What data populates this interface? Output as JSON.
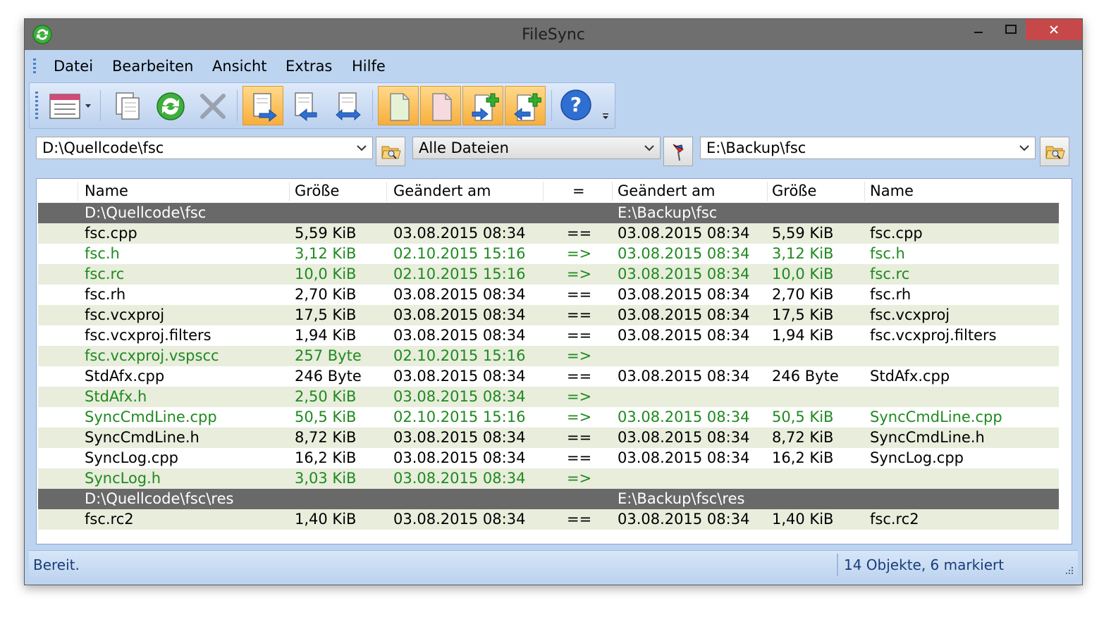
{
  "window": {
    "title": "FileSync"
  },
  "menu": {
    "items": [
      "Datei",
      "Bearbeiten",
      "Ansicht",
      "Extras",
      "Hilfe"
    ]
  },
  "paths": {
    "left": "D:\\Quellcode\\fsc",
    "filter": "Alle Dateien",
    "right": "E:\\Backup\\fsc"
  },
  "columns": {
    "name": "Name",
    "size": "Größe",
    "modified": "Geändert am",
    "compare": "=",
    "modified_right": "Geändert am",
    "size_right": "Größe",
    "name_right": "Name"
  },
  "rows": [
    {
      "type": "folder",
      "left_name": "D:\\Quellcode\\fsc",
      "left_size": "",
      "left_date": "",
      "op": "",
      "right_date": "E:\\Backup\\fsc",
      "right_size": "",
      "right_name": ""
    },
    {
      "type": "equal",
      "left_name": "fsc.cpp",
      "left_size": "5,59 KiB",
      "left_date": "03.08.2015  08:34",
      "op": "==",
      "right_date": "03.08.2015  08:34",
      "right_size": "5,59 KiB",
      "right_name": "fsc.cpp"
    },
    {
      "type": "newer",
      "left_name": "fsc.h",
      "left_size": "3,12 KiB",
      "left_date": "02.10.2015  15:16",
      "op": "=>",
      "right_date": "03.08.2015  08:34",
      "right_size": "3,12 KiB",
      "right_name": "fsc.h"
    },
    {
      "type": "newer",
      "left_name": "fsc.rc",
      "left_size": "10,0 KiB",
      "left_date": "02.10.2015  15:16",
      "op": "=>",
      "right_date": "03.08.2015  08:34",
      "right_size": "10,0 KiB",
      "right_name": "fsc.rc"
    },
    {
      "type": "equal",
      "left_name": "fsc.rh",
      "left_size": "2,70 KiB",
      "left_date": "03.08.2015  08:34",
      "op": "==",
      "right_date": "03.08.2015  08:34",
      "right_size": "2,70 KiB",
      "right_name": "fsc.rh"
    },
    {
      "type": "equal",
      "left_name": "fsc.vcxproj",
      "left_size": "17,5 KiB",
      "left_date": "03.08.2015  08:34",
      "op": "==",
      "right_date": "03.08.2015  08:34",
      "right_size": "17,5 KiB",
      "right_name": "fsc.vcxproj"
    },
    {
      "type": "equal",
      "left_name": "fsc.vcxproj.filters",
      "left_size": "1,94 KiB",
      "left_date": "03.08.2015  08:34",
      "op": "==",
      "right_date": "03.08.2015  08:34",
      "right_size": "1,94 KiB",
      "right_name": "fsc.vcxproj.filters"
    },
    {
      "type": "newer",
      "left_name": "fsc.vcxproj.vspscc",
      "left_size": "257 Byte",
      "left_date": "02.10.2015  15:16",
      "op": "=>",
      "right_date": "",
      "right_size": "",
      "right_name": ""
    },
    {
      "type": "equal",
      "left_name": "StdAfx.cpp",
      "left_size": "246 Byte",
      "left_date": "03.08.2015  08:34",
      "op": "==",
      "right_date": "03.08.2015  08:34",
      "right_size": "246 Byte",
      "right_name": "StdAfx.cpp"
    },
    {
      "type": "newer",
      "left_name": "StdAfx.h",
      "left_size": "2,50 KiB",
      "left_date": "03.08.2015  08:34",
      "op": "=>",
      "right_date": "",
      "right_size": "",
      "right_name": ""
    },
    {
      "type": "newer",
      "left_name": "SyncCmdLine.cpp",
      "left_size": "50,5 KiB",
      "left_date": "02.10.2015  15:16",
      "op": "=>",
      "right_date": "03.08.2015  08:34",
      "right_size": "50,5 KiB",
      "right_name": "SyncCmdLine.cpp"
    },
    {
      "type": "equal",
      "left_name": "SyncCmdLine.h",
      "left_size": "8,72 KiB",
      "left_date": "03.08.2015  08:34",
      "op": "==",
      "right_date": "03.08.2015  08:34",
      "right_size": "8,72 KiB",
      "right_name": "SyncCmdLine.h"
    },
    {
      "type": "equal",
      "left_name": "SyncLog.cpp",
      "left_size": "16,2 KiB",
      "left_date": "03.08.2015  08:34",
      "op": "==",
      "right_date": "03.08.2015  08:34",
      "right_size": "16,2 KiB",
      "right_name": "SyncLog.cpp"
    },
    {
      "type": "newer",
      "left_name": "SyncLog.h",
      "left_size": "3,03 KiB",
      "left_date": "03.08.2015  08:34",
      "op": "=>",
      "right_date": "",
      "right_size": "",
      "right_name": ""
    },
    {
      "type": "folder",
      "left_name": "D:\\Quellcode\\fsc\\res",
      "left_size": "",
      "left_date": "",
      "op": "",
      "right_date": "E:\\Backup\\fsc\\res",
      "right_size": "",
      "right_name": ""
    },
    {
      "type": "equal",
      "left_name": "fsc.rc2",
      "left_size": "1,40 KiB",
      "left_date": "03.08.2015  08:34",
      "op": "==",
      "right_date": "03.08.2015  08:34",
      "right_size": "1,40 KiB",
      "right_name": "fsc.rc2"
    }
  ],
  "status": {
    "left": "Bereit.",
    "right": "14 Objekte, 6 markiert"
  },
  "colors": {
    "newer_text": "#1f8a1f",
    "folder_row": "#696969",
    "alt_row": "#e8eddc",
    "close_button": "#c74848",
    "toolbar_active": "#f8ae3c"
  },
  "icons": [
    "app-sync-icon",
    "view-options-icon",
    "copy-icon",
    "refresh-icon",
    "delete-icon",
    "copy-right-icon",
    "copy-left-icon",
    "copy-both-icon",
    "new-file-left-icon",
    "new-file-right-icon",
    "add-right-icon",
    "add-left-icon",
    "help-icon",
    "folder-browse-icon",
    "filter-icon"
  ]
}
